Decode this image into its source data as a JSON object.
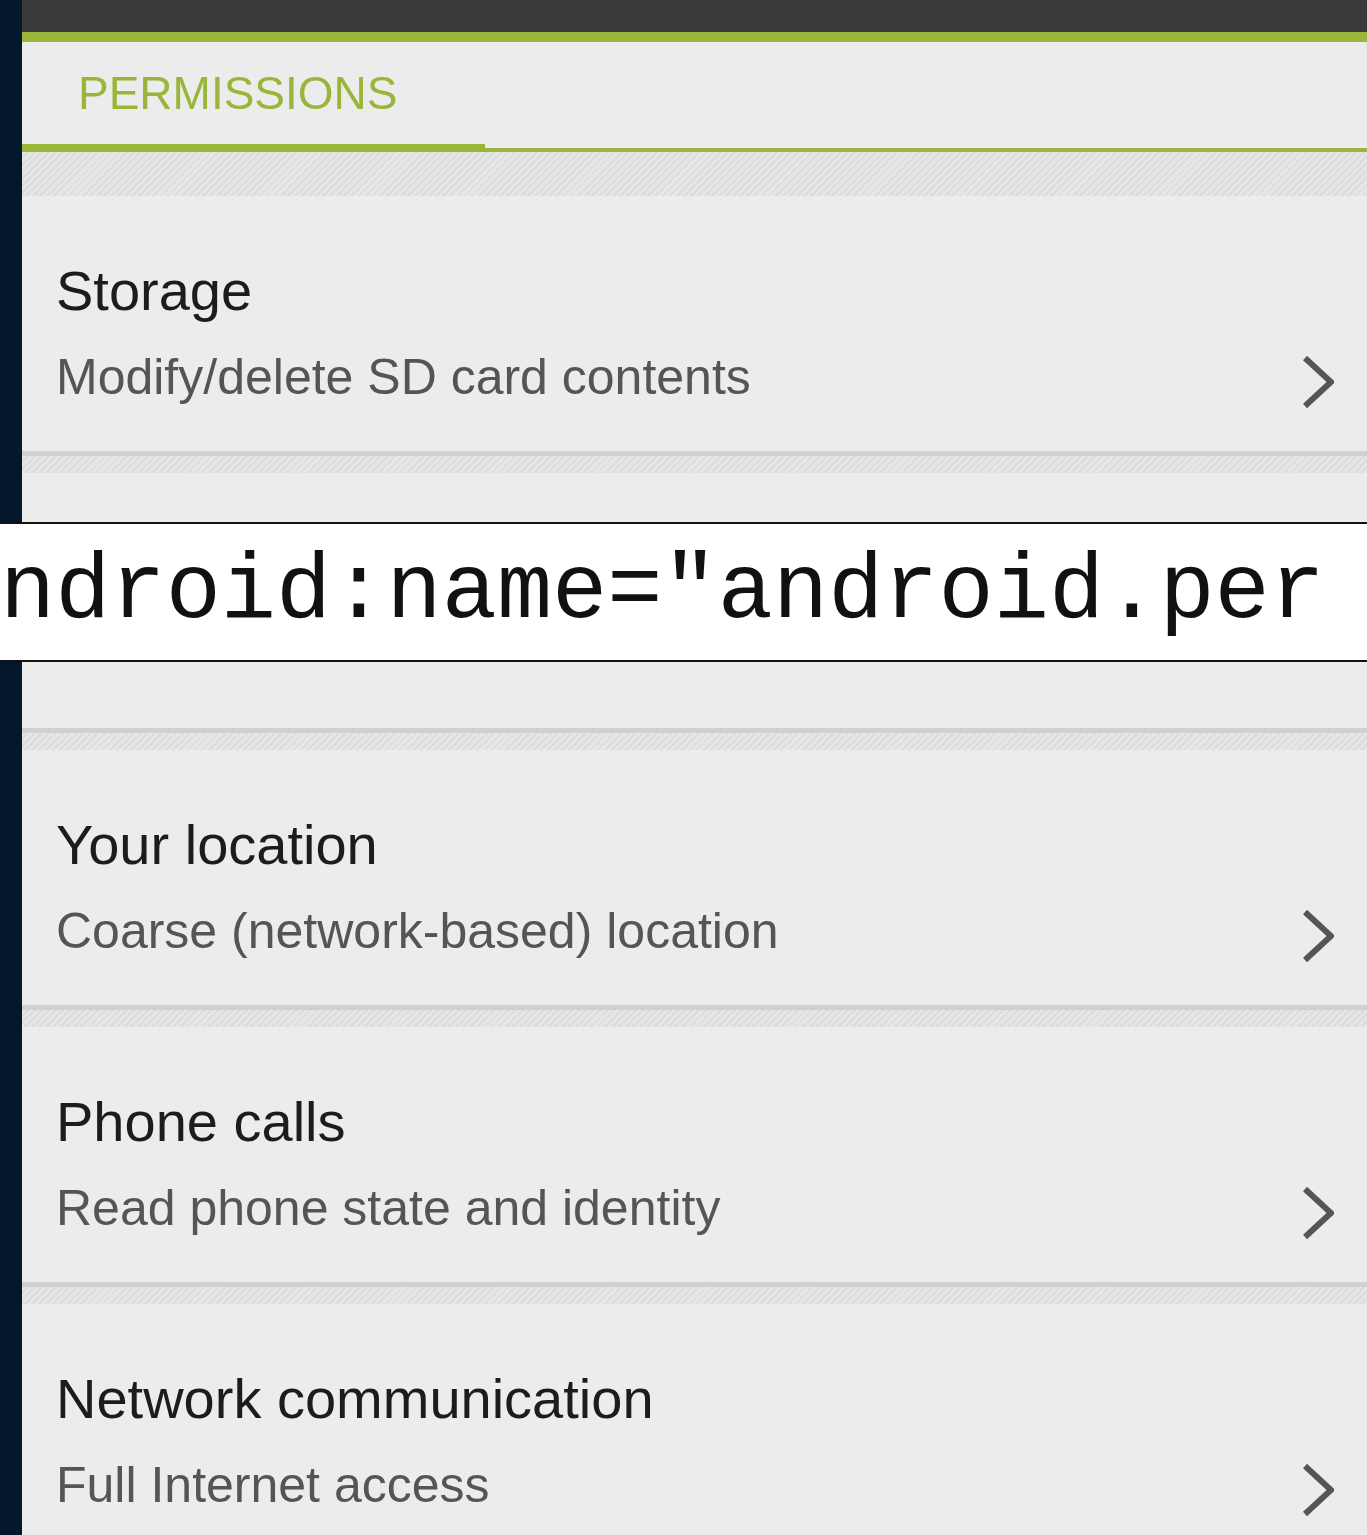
{
  "tabs": [
    {
      "label": "PERMISSIONS",
      "selected": true
    }
  ],
  "permissions": [
    {
      "title": "Storage",
      "description": "Modify/delete SD card contents"
    },
    {
      "covered": true
    },
    {
      "title": "Your location",
      "description": "Coarse (network-based) location"
    },
    {
      "title": "Phone calls",
      "description": "Read phone state and identity"
    },
    {
      "title": "Network communication",
      "description": "Full Internet access"
    }
  ],
  "code_overlay": {
    "text": "ndroid:name=\"android.per"
  }
}
